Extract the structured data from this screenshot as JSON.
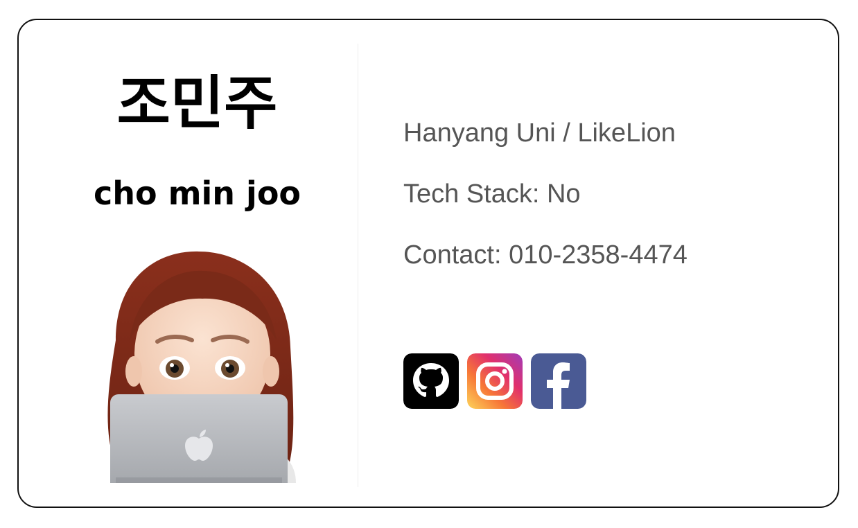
{
  "profile": {
    "name_ko": "조민주",
    "name_en": "cho min joo"
  },
  "info": {
    "line1": "Hanyang Uni / LikeLion",
    "line2": "Tech Stack: No",
    "line3": "Contact: 010-2358-4474"
  },
  "socials": [
    {
      "icon": "github-icon",
      "color": "#000000"
    },
    {
      "icon": "instagram-icon",
      "color": "#E1306C"
    },
    {
      "icon": "facebook-icon",
      "color": "#4A5A94"
    }
  ],
  "colors": {
    "text_primary": "#000000",
    "text_secondary": "#555555",
    "border": "#111111"
  }
}
